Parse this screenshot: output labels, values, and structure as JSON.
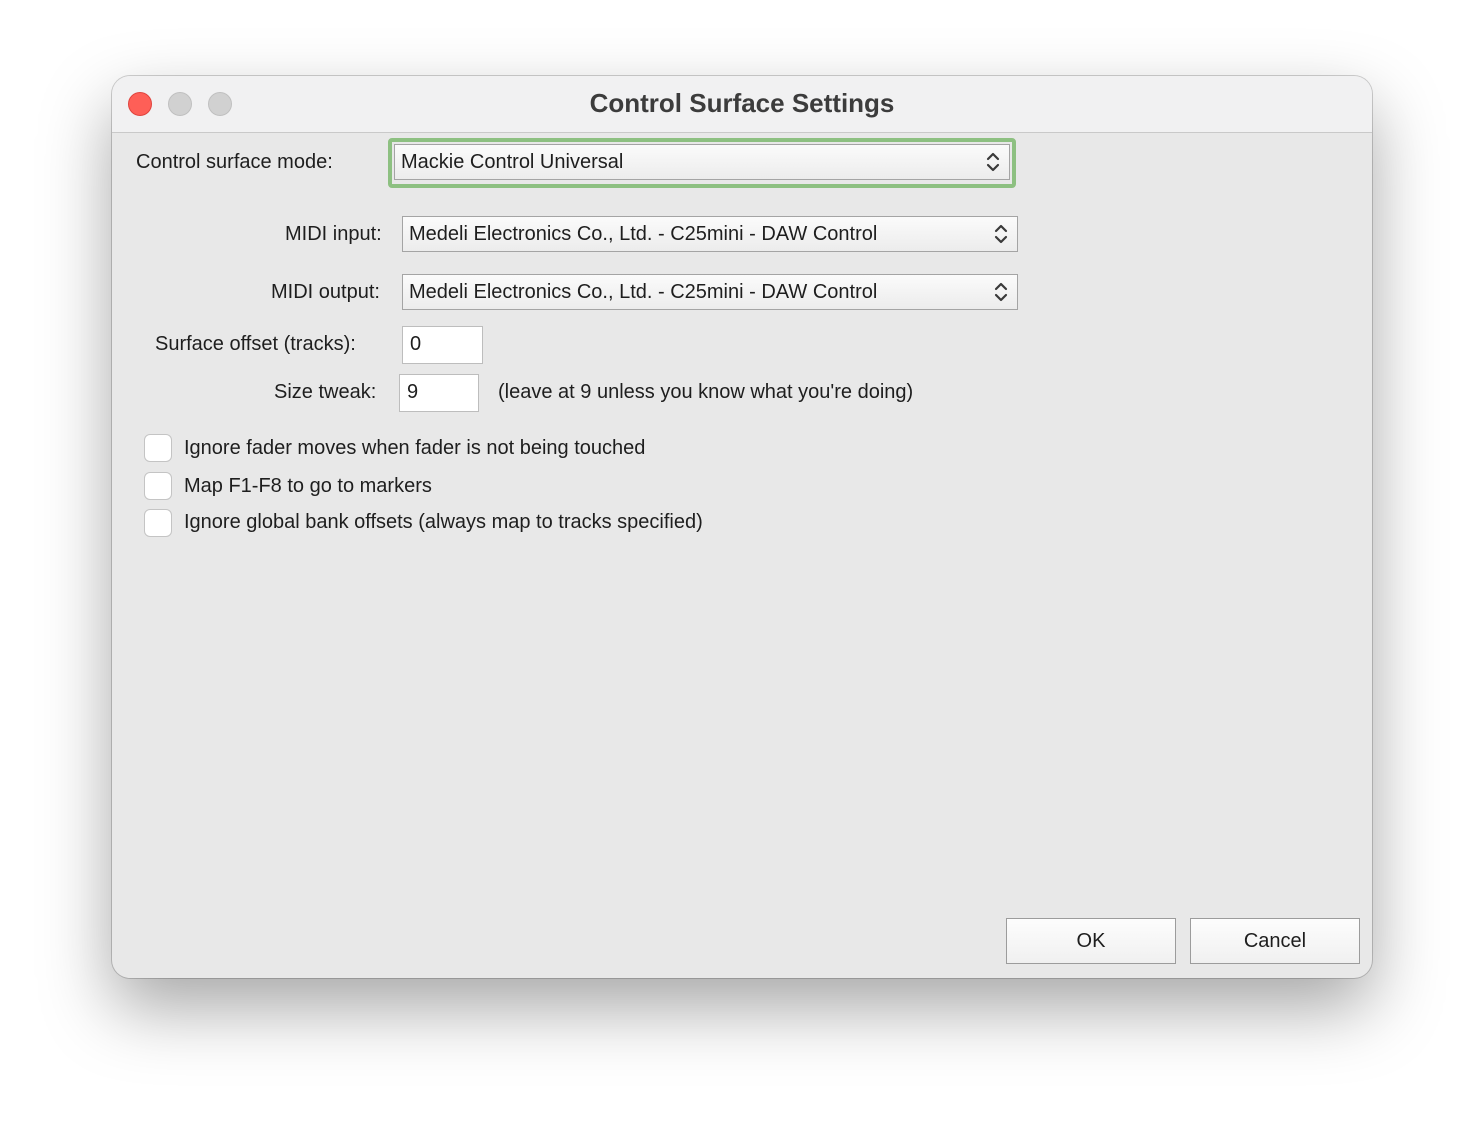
{
  "window": {
    "title": "Control Surface Settings"
  },
  "form": {
    "mode_label": "Control surface mode:",
    "mode_value": "Mackie Control Universal",
    "midi_input_label": "MIDI input:",
    "midi_input_value": "Medeli Electronics Co., Ltd. - C25mini - DAW Control",
    "midi_output_label": "MIDI output:",
    "midi_output_value": "Medeli Electronics Co., Ltd. - C25mini - DAW Control",
    "surface_offset_label": "Surface offset (tracks):",
    "surface_offset_value": "0",
    "size_tweak_label": "Size tweak:",
    "size_tweak_value": "9",
    "size_tweak_hint": "(leave at 9 unless you know what you're doing)"
  },
  "checkboxes": [
    {
      "label": "Ignore fader moves when fader is not being touched",
      "checked": false
    },
    {
      "label": "Map F1-F8 to go to markers",
      "checked": false
    },
    {
      "label": "Ignore global bank offsets (always map to tracks specified)",
      "checked": false
    }
  ],
  "buttons": {
    "ok": "OK",
    "cancel": "Cancel"
  },
  "colors": {
    "close_button": "#fe5f57",
    "focus_ring": "#8dc081",
    "window_background": "#e8e8e8"
  },
  "icons": {
    "select_arrows": "chevron-up-down-icon"
  }
}
